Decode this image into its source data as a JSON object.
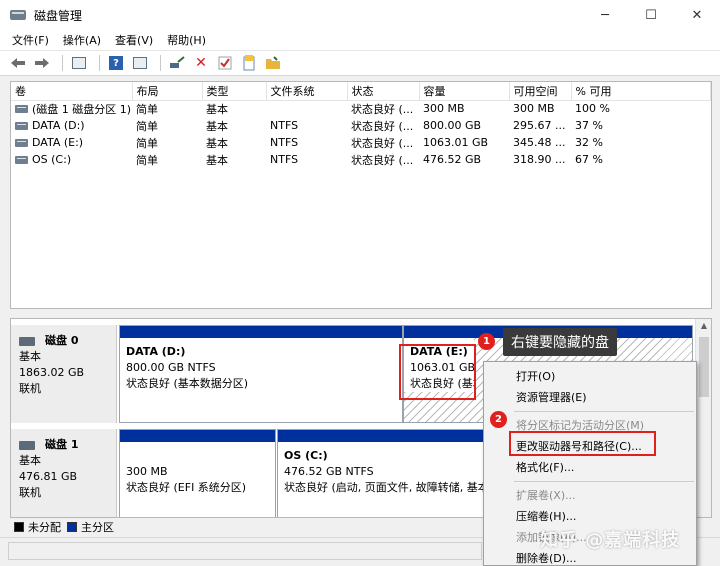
{
  "window": {
    "title": "磁盘管理",
    "controls": {
      "minimize": "─",
      "maximize": "☐",
      "close": "✕"
    }
  },
  "menu": [
    "文件(F)",
    "操作(A)",
    "查看(V)",
    "帮助(H)"
  ],
  "toolbar": {
    "icons": [
      "back-arrow-icon",
      "forward-arrow-icon",
      "list-view-icon",
      "help-icon",
      "properties-icon",
      "connect-icon",
      "delete-icon",
      "check-icon",
      "new-doc-icon",
      "folder-icon"
    ]
  },
  "volume_table": {
    "columns": [
      "卷",
      "布局",
      "类型",
      "文件系统",
      "状态",
      "容量",
      "可用空间",
      "% 可用"
    ],
    "rows": [
      [
        "(磁盘 1 磁盘分区 1)",
        "简单",
        "基本",
        "",
        "状态良好 (...",
        "300 MB",
        "300 MB",
        "100 %"
      ],
      [
        "DATA (D:)",
        "简单",
        "基本",
        "NTFS",
        "状态良好 (...",
        "800.00 GB",
        "295.67 ...",
        "37 %"
      ],
      [
        "DATA (E:)",
        "简单",
        "基本",
        "NTFS",
        "状态良好 (...",
        "1063.01 GB",
        "345.48 ...",
        "32 %"
      ],
      [
        "OS (C:)",
        "简单",
        "基本",
        "NTFS",
        "状态良好 (...",
        "476.52 GB",
        "318.90 ...",
        "67 %"
      ]
    ]
  },
  "disks": [
    {
      "name": "磁盘 0",
      "type": "基本",
      "size": "1863.02 GB",
      "status": "联机",
      "partitions": [
        {
          "name": "DATA  (D:)",
          "size": "800.00 GB NTFS",
          "status": "状态良好 (基本数据分区)"
        },
        {
          "name": "DATA  (E:)",
          "size": "1063.01 GB N",
          "status": "状态良好 (基本"
        }
      ]
    },
    {
      "name": "磁盘 1",
      "type": "基本",
      "size": "476.81 GB",
      "status": "联机",
      "partitions": [
        {
          "name": "",
          "size": "300 MB",
          "status": "状态良好 (EFI 系统分区)"
        },
        {
          "name": "OS  (C:)",
          "size": "476.52 GB NTFS",
          "status": "状态良好 (启动, 页面文件, 故障转储, 基本"
        }
      ]
    }
  ],
  "legend": [
    {
      "label": "未分配",
      "color": "#000000"
    },
    {
      "label": "主分区",
      "color": "#00309c"
    }
  ],
  "annotations": {
    "step1": "1",
    "step1_text": "右键要隐藏的盘",
    "step2": "2"
  },
  "context_menu": [
    {
      "label": "打开(O)",
      "disabled": false
    },
    {
      "label": "资源管理器(E)",
      "disabled": false
    },
    {
      "sep": true
    },
    {
      "label": "将分区标记为活动分区(M)",
      "disabled": true
    },
    {
      "label": "更改驱动器号和路径(C)...",
      "disabled": false,
      "highlighted": true
    },
    {
      "label": "格式化(F)...",
      "disabled": false
    },
    {
      "sep": true
    },
    {
      "label": "扩展卷(X)...",
      "disabled": true
    },
    {
      "label": "压缩卷(H)...",
      "disabled": false
    },
    {
      "label": "添加镜像(A)...",
      "disabled": true
    },
    {
      "label": "删除卷(D)...",
      "disabled": false
    }
  ],
  "watermark": "知乎 @嘉端科技",
  "colors": {
    "accent_red": "#e0201c",
    "primary_partition": "#00309c",
    "callout_bg": "#3a3a3a"
  }
}
